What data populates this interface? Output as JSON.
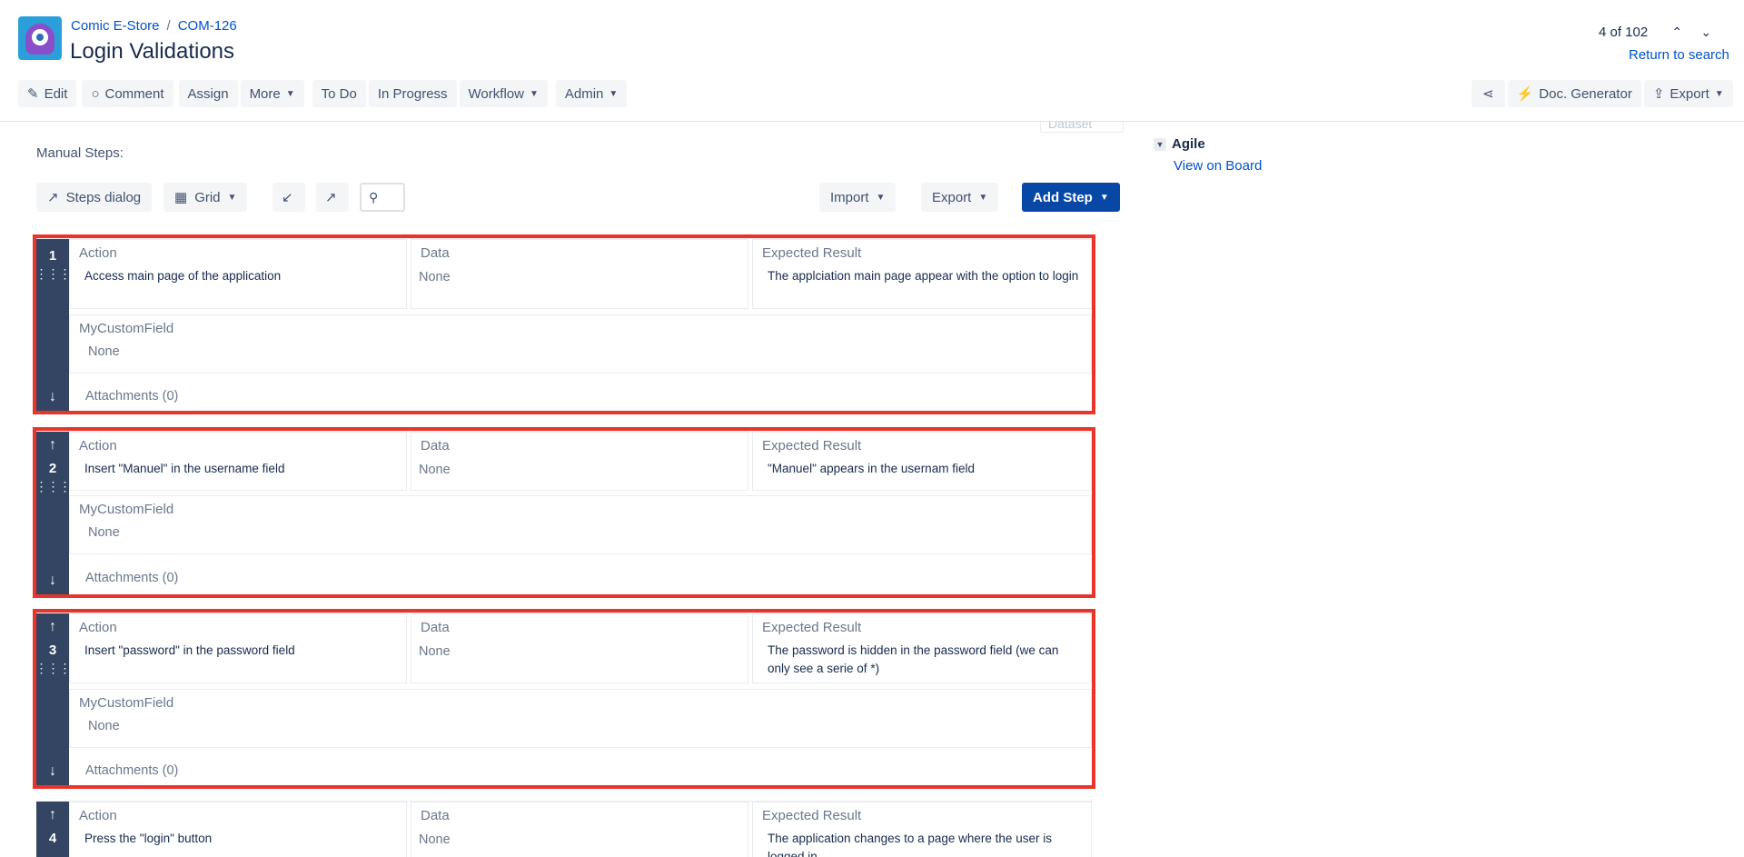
{
  "header": {
    "breadcrumbs": [
      "Comic E-Store",
      "COM-126"
    ],
    "breadcrumb_sep": "/",
    "title": "Login Validations",
    "pager": "4 of 102",
    "return_link": "Return to search"
  },
  "toolbar": {
    "edit": "Edit",
    "comment": "Comment",
    "assign": "Assign",
    "more": "More",
    "todo": "To Do",
    "in_progress": "In Progress",
    "workflow": "Workflow",
    "admin": "Admin",
    "doc_generator": "Doc. Generator",
    "export": "Export"
  },
  "faded_button": "Dataset",
  "manual_steps_label": "Manual Steps:",
  "grid_toolbar": {
    "steps_dialog": "Steps dialog",
    "grid": "Grid",
    "import": "Import",
    "export": "Export",
    "add_step": "Add Step"
  },
  "field_labels": {
    "action": "Action",
    "data": "Data",
    "expected": "Expected Result",
    "custom": "MyCustomField"
  },
  "steps": [
    {
      "num": "1",
      "action": "Access main page of the application",
      "data": "None",
      "expected": "The applciation main page appear with the option to login",
      "custom": "None",
      "attachments": "Attachments (0)"
    },
    {
      "num": "2",
      "action": "Insert \"Manuel\" in the username field",
      "data": "None",
      "expected": "\"Manuel\" appears in the usernam field",
      "custom": "None",
      "attachments": "Attachments (0)"
    },
    {
      "num": "3",
      "action": "Insert \"password\" in the password field",
      "data": "None",
      "expected": "The password is hidden in the password field (we can only see a serie of *)",
      "custom": "None",
      "attachments": "Attachments (0)"
    },
    {
      "num": "4",
      "action": "Press the \"login\" button",
      "data": "None",
      "expected": "The application changes to a page where the user is logged in"
    }
  ],
  "sidebar": {
    "agile_label": "Agile",
    "view_on_board": "View on Board"
  },
  "colors": {
    "highlight": "#e8352a",
    "rail": "#344563",
    "link": "#0052cc",
    "primary_button": "#0747a6"
  }
}
